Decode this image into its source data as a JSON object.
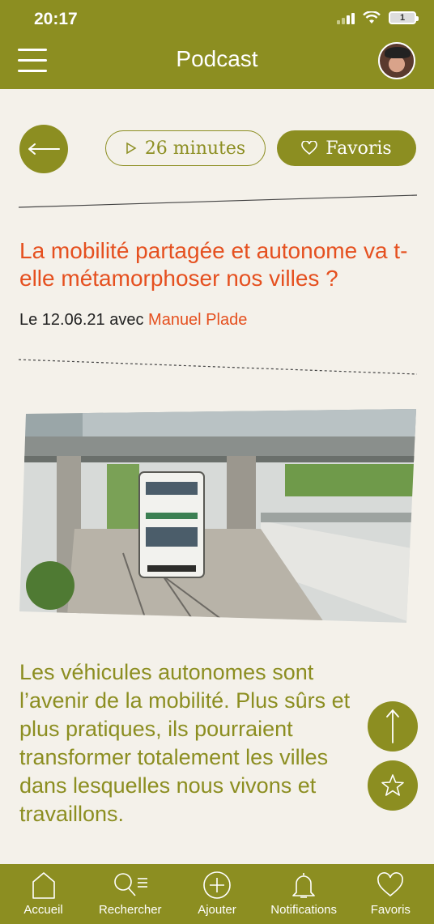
{
  "status_bar": {
    "time": "20:17",
    "battery": "1"
  },
  "header": {
    "title": "Podcast"
  },
  "actions": {
    "duration": "26 minutes",
    "favorite": "Favoris"
  },
  "article": {
    "title": "La mobilité partagée et autonome va t-elle métamorphoser nos villes ?",
    "date_prefix": "Le 12.06.21 avec",
    "author": "Manuel Plade",
    "body": "Les véhicules autonomes sont l’avenir de la mobilité. Plus sûrs et plus pratiques, ils pourraient transformer totalement les villes dans lesquelles nous vivons et travaillons."
  },
  "tabbar": {
    "items": [
      {
        "label": "Accueil",
        "icon": "home-icon"
      },
      {
        "label": "Rechercher",
        "icon": "search-icon"
      },
      {
        "label": "Ajouter",
        "icon": "plus-circle-icon"
      },
      {
        "label": "Notifications",
        "icon": "bell-icon"
      },
      {
        "label": "Favoris",
        "icon": "heart-icon"
      }
    ]
  },
  "colors": {
    "accent": "#8c8e21",
    "highlight": "#e5501f",
    "background": "#f4f1ea"
  }
}
